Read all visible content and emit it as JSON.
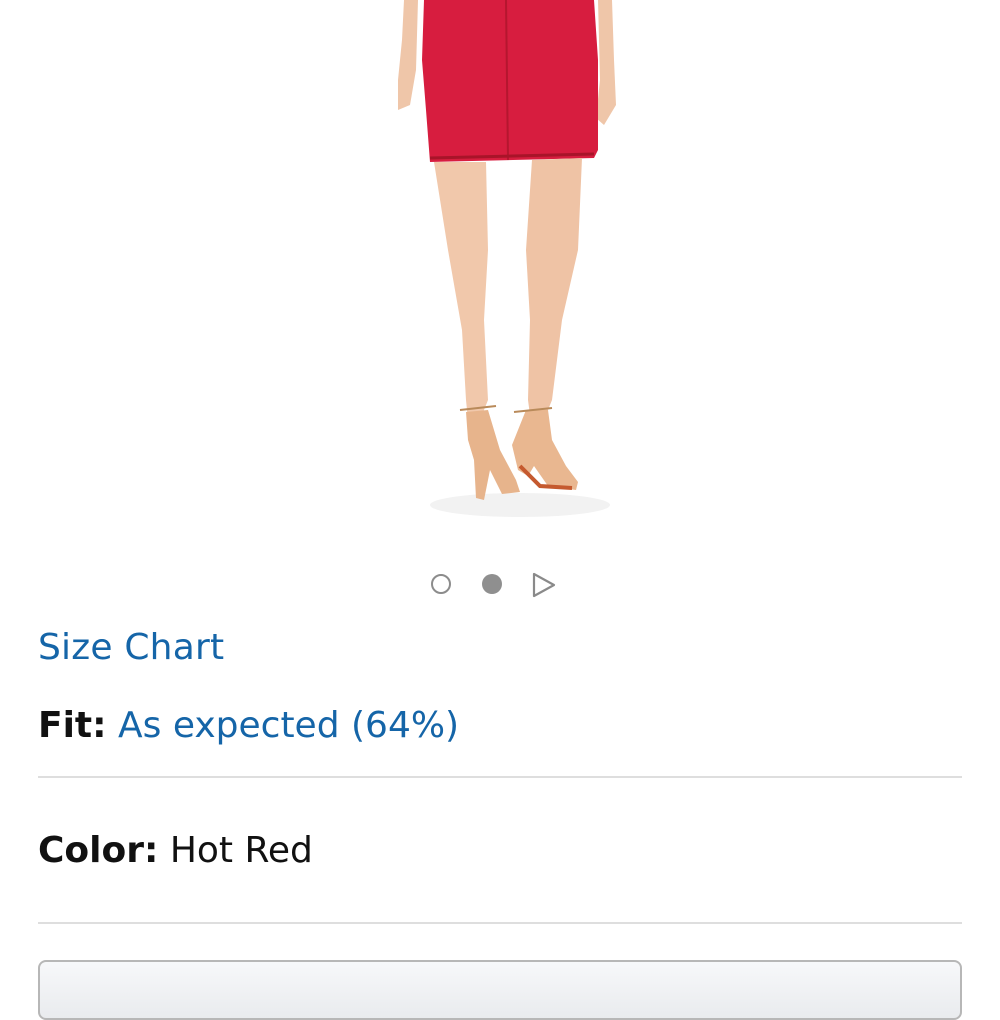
{
  "product_image": {
    "alt_description": "",
    "accent_color": "#d71d3f"
  },
  "carousel": {
    "dots": [
      "image-1",
      "image-2"
    ],
    "active_index": 1,
    "play_icon": "play-triangle-icon"
  },
  "size_chart": {
    "label": "Size Chart"
  },
  "fit": {
    "label": "Fit:",
    "value": "As expected (64%)"
  },
  "color": {
    "label": "Color:",
    "value": "Hot Red"
  },
  "colors": {
    "link": "#1565a8",
    "divider": "#dedede"
  }
}
